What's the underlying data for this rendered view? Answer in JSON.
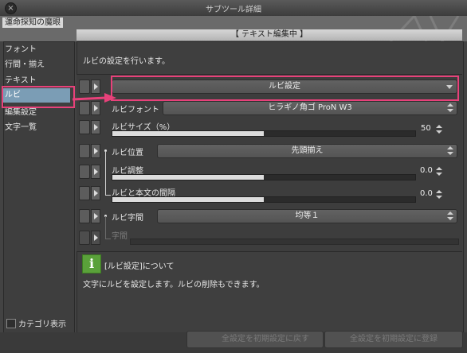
{
  "window": {
    "title": "サブツール詳細",
    "close_icon": "close-icon"
  },
  "document": {
    "title": "運命探知の魔眼",
    "mode_label": "【 テキスト編集中 】"
  },
  "categories": [
    {
      "label": "フォント"
    },
    {
      "label": "行間・揃え"
    },
    {
      "label": "テキスト"
    },
    {
      "label": "ルビ"
    },
    {
      "label": "編集設定"
    },
    {
      "label": "文字一覧"
    }
  ],
  "selected_category": "ルビ",
  "category_display": {
    "label": "カテゴリ表示",
    "checked": false
  },
  "main": {
    "description": "ルビの設定を行います。",
    "ruby_setting": {
      "value": "ルビ設定"
    },
    "ruby_font": {
      "label": "ルビフォント",
      "value": "ヒラギノ角ゴ ProN W3"
    },
    "ruby_size": {
      "label": "ルビサイズ（%）",
      "value": "50",
      "fraction": 0.5
    },
    "ruby_position": {
      "label": "ルビ位置",
      "value": "先頭揃え"
    },
    "ruby_adjust": {
      "label": "ルビ調整",
      "value": "0.0",
      "fraction": 0.5
    },
    "ruby_gap": {
      "label": "ルビと本文の間隔",
      "value": "0.0",
      "fraction": 0.5
    },
    "ruby_spacing": {
      "label": "ルビ字間",
      "value": "均等１"
    },
    "char_spacing": {
      "label": "字間"
    }
  },
  "info": {
    "icon": "info-icon",
    "title": "[ルビ設定]について",
    "body": "文字にルビを設定します。ルビの削除もできます。"
  },
  "buttons": {
    "reset_all": "全設定を初期設定に戻す",
    "register_all": "全設定を初期設定に登録"
  },
  "colors": {
    "highlight": "#e8417a",
    "selection": "#7b9db5",
    "info_green": "#5aa13a"
  }
}
